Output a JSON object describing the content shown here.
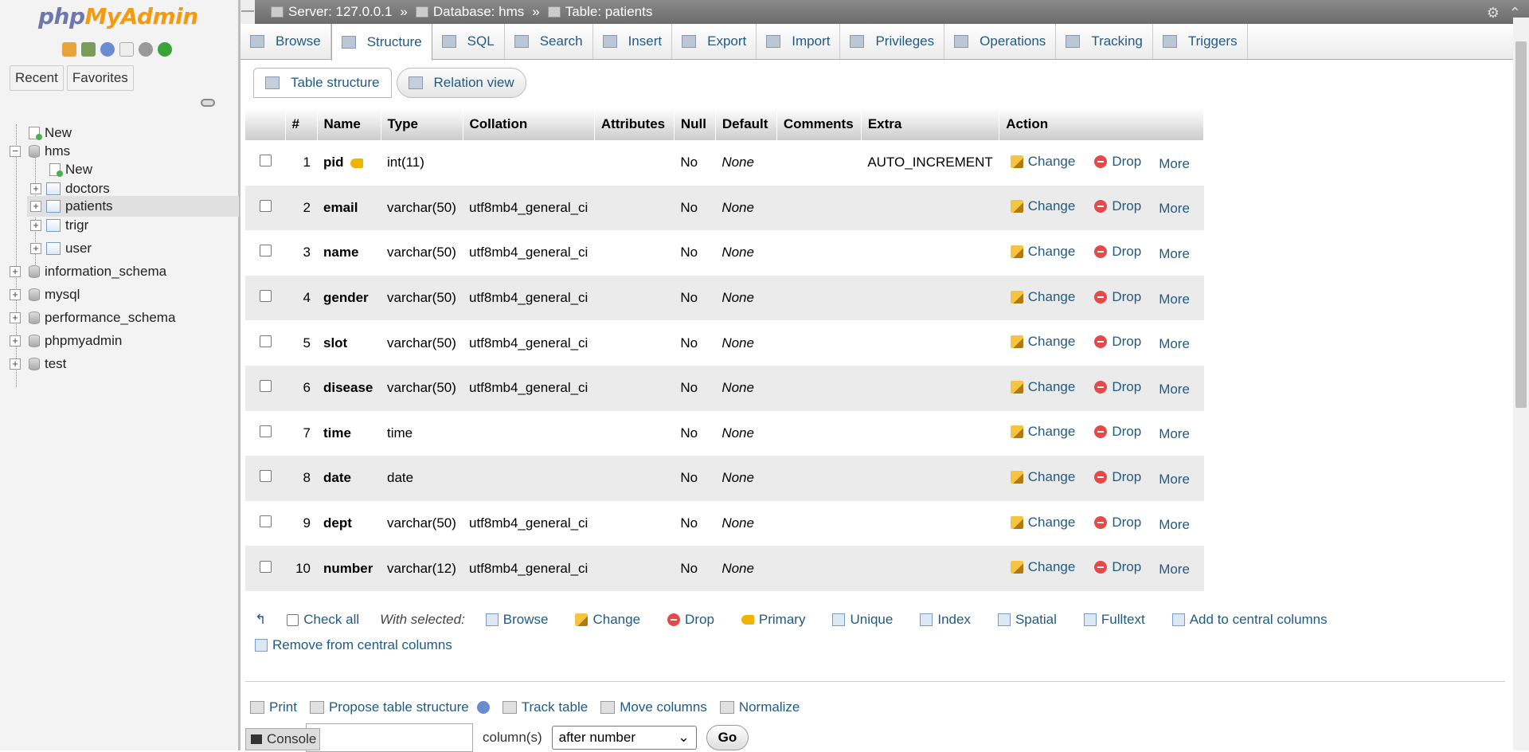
{
  "sidebar": {
    "logo_php": "php",
    "logo_myadmin": "MyAdmin",
    "tabs": {
      "recent": "Recent",
      "favorites": "Favorites"
    },
    "tree": [
      {
        "label": "New",
        "kind": "new"
      },
      {
        "label": "hms",
        "kind": "db",
        "expanded": true
      },
      {
        "label": "New",
        "kind": "new"
      },
      {
        "label": "doctors",
        "kind": "table"
      },
      {
        "label": "patients",
        "kind": "table",
        "selected": true
      },
      {
        "label": "trigr",
        "kind": "table"
      },
      {
        "label": "user",
        "kind": "table"
      },
      {
        "label": "information_schema",
        "kind": "db"
      },
      {
        "label": "mysql",
        "kind": "db"
      },
      {
        "label": "performance_schema",
        "kind": "db"
      },
      {
        "label": "phpmyadmin",
        "kind": "db"
      },
      {
        "label": "test",
        "kind": "db"
      }
    ]
  },
  "breadcrumb": {
    "server": "Server: 127.0.0.1",
    "database": "Database: hms",
    "table": "Table: patients",
    "sep": "»"
  },
  "tabs": [
    "Browse",
    "Structure",
    "SQL",
    "Search",
    "Insert",
    "Export",
    "Import",
    "Privileges",
    "Operations",
    "Tracking",
    "Triggers"
  ],
  "active_tab": "Structure",
  "subtabs": {
    "table_structure": "Table structure",
    "relation_view": "Relation view"
  },
  "table": {
    "headers": [
      "#",
      "Name",
      "Type",
      "Collation",
      "Attributes",
      "Null",
      "Default",
      "Comments",
      "Extra",
      "Action"
    ],
    "rows": [
      {
        "num": "1",
        "name": "pid",
        "type": "int(11)",
        "collation": "",
        "attributes": "",
        "null": "No",
        "default": "None",
        "comments": "",
        "extra": "AUTO_INCREMENT"
      },
      {
        "num": "2",
        "name": "email",
        "type": "varchar(50)",
        "collation": "utf8mb4_general_ci",
        "attributes": "",
        "null": "No",
        "default": "None",
        "comments": "",
        "extra": ""
      },
      {
        "num": "3",
        "name": "name",
        "type": "varchar(50)",
        "collation": "utf8mb4_general_ci",
        "attributes": "",
        "null": "No",
        "default": "None",
        "comments": "",
        "extra": ""
      },
      {
        "num": "4",
        "name": "gender",
        "type": "varchar(50)",
        "collation": "utf8mb4_general_ci",
        "attributes": "",
        "null": "No",
        "default": "None",
        "comments": "",
        "extra": ""
      },
      {
        "num": "5",
        "name": "slot",
        "type": "varchar(50)",
        "collation": "utf8mb4_general_ci",
        "attributes": "",
        "null": "No",
        "default": "None",
        "comments": "",
        "extra": ""
      },
      {
        "num": "6",
        "name": "disease",
        "type": "varchar(50)",
        "collation": "utf8mb4_general_ci",
        "attributes": "",
        "null": "No",
        "default": "None",
        "comments": "",
        "extra": ""
      },
      {
        "num": "7",
        "name": "time",
        "type": "time",
        "collation": "",
        "attributes": "",
        "null": "No",
        "default": "None",
        "comments": "",
        "extra": ""
      },
      {
        "num": "8",
        "name": "date",
        "type": "date",
        "collation": "",
        "attributes": "",
        "null": "No",
        "default": "None",
        "comments": "",
        "extra": ""
      },
      {
        "num": "9",
        "name": "dept",
        "type": "varchar(50)",
        "collation": "utf8mb4_general_ci",
        "attributes": "",
        "null": "No",
        "default": "None",
        "comments": "",
        "extra": ""
      },
      {
        "num": "10",
        "name": "number",
        "type": "varchar(12)",
        "collation": "utf8mb4_general_ci",
        "attributes": "",
        "null": "No",
        "default": "None",
        "comments": "",
        "extra": ""
      }
    ],
    "actions": {
      "change": "Change",
      "drop": "Drop",
      "more": "More"
    }
  },
  "bulk": {
    "check_all": "Check all",
    "with_selected": "With selected:",
    "items": [
      "Browse",
      "Change",
      "Drop",
      "Primary",
      "Unique",
      "Index",
      "Spatial",
      "Fulltext",
      "Add to central columns",
      "Remove from central columns"
    ]
  },
  "footer_links": [
    "Print",
    "Propose table structure",
    "Track table",
    "Move columns",
    "Normalize"
  ],
  "add_columns": {
    "label": "column(s)",
    "position": "after number",
    "go": "Go"
  },
  "console": "Console"
}
